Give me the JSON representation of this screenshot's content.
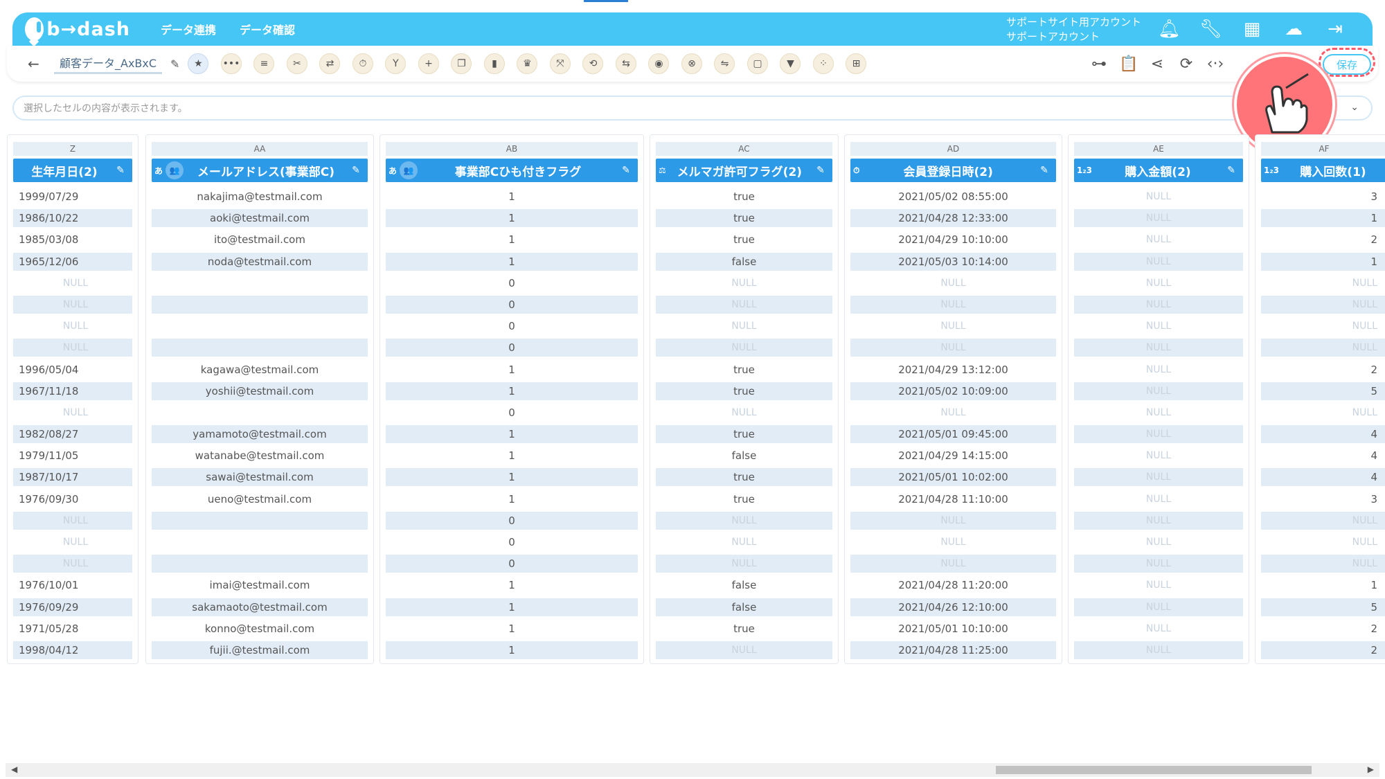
{
  "brand": {
    "logo_text": "b→dash"
  },
  "nav": {
    "links": [
      "データ連携",
      "データ確認"
    ]
  },
  "account": {
    "line1": "サポートサイト用アカウント",
    "line2": "サポートアカウント"
  },
  "top_icons": [
    "bell-icon",
    "wrench-icon",
    "apps-grid-icon",
    "chat-robot-icon",
    "logout-icon"
  ],
  "toolbar": {
    "back": "←",
    "file_name": "顧客データ_AxBxC",
    "save_label": "保存",
    "tools": [
      {
        "name": "favorite-star-icon",
        "glyph": "★"
      },
      {
        "name": "more-dots-icon",
        "glyph": "•••"
      },
      {
        "name": "list-icon",
        "glyph": "≡"
      },
      {
        "name": "scissors-tools-icon",
        "glyph": "✂"
      },
      {
        "name": "merge-arrows-icon",
        "glyph": "⇄"
      },
      {
        "name": "timer-icon",
        "glyph": "⏱"
      },
      {
        "name": "branch-icon",
        "glyph": "Y"
      },
      {
        "name": "add-icon",
        "glyph": "+"
      },
      {
        "name": "copy-icon",
        "glyph": "❐"
      },
      {
        "name": "trash-icon",
        "glyph": "▮"
      },
      {
        "name": "crown-icon",
        "glyph": "♛"
      },
      {
        "name": "expand-icon",
        "glyph": "⤧"
      },
      {
        "name": "repeat-icon",
        "glyph": "⟲"
      },
      {
        "name": "convert-icon",
        "glyph": "⇆"
      },
      {
        "name": "bag-icon",
        "glyph": "◉"
      },
      {
        "name": "cancel-circle-icon",
        "glyph": "⊗"
      },
      {
        "name": "replace-icon",
        "glyph": "⇋"
      },
      {
        "name": "frame-icon",
        "glyph": "▢"
      },
      {
        "name": "filter-icon",
        "glyph": "▼"
      },
      {
        "name": "grid-dots-icon",
        "glyph": "⁘"
      },
      {
        "name": "table-icon",
        "glyph": "⊞"
      }
    ],
    "right_tools": [
      {
        "name": "flow-icon",
        "glyph": "⊶"
      },
      {
        "name": "clipboard-icon",
        "glyph": "📋"
      },
      {
        "name": "share-icon",
        "glyph": "⋖"
      },
      {
        "name": "refresh-doc-icon",
        "glyph": "⟳"
      },
      {
        "name": "code-icon",
        "glyph": "‹·›"
      }
    ]
  },
  "cell_bar": {
    "placeholder": "選択したセルの内容が表示されます。"
  },
  "columns": [
    {
      "letter": "Z",
      "title": "生年月日(2)",
      "icons": [],
      "align": "left",
      "values": [
        "1999/07/29",
        "1986/10/22",
        "1985/03/08",
        "1965/12/06",
        "NULL",
        "NULL",
        "NULL",
        "NULL",
        "1996/05/04",
        "1967/11/18",
        "NULL",
        "1982/08/27",
        "1979/11/05",
        "1987/10/17",
        "1976/09/30",
        "NULL",
        "NULL",
        "NULL",
        "1976/10/01",
        "1976/09/29",
        "1971/05/28",
        "1998/04/12"
      ]
    },
    {
      "letter": "AA",
      "title": "メールアドレス(事業部C)",
      "icons": [
        "あ",
        "👥"
      ],
      "align": "center",
      "values": [
        "nakajima@testmail.com",
        "aoki@testmail.com",
        "ito@testmail.com",
        "noda@testmail.com",
        "",
        "",
        "",
        "",
        "kagawa@testmail.com",
        "yoshii@testmail.com",
        "",
        "yamamoto@testmail.com",
        "watanabe@testmail.com",
        "sawai@testmail.com",
        "ueno@testmail.com",
        "",
        "",
        "",
        "imai@testmail.com",
        "sakamaoto@testmail.com",
        "konno@testmail.com",
        "fujii.@testmail.com"
      ]
    },
    {
      "letter": "AB",
      "title": "事業部Cひも付きフラグ",
      "icons": [
        "あ",
        "👥"
      ],
      "align": "center",
      "values": [
        "1",
        "1",
        "1",
        "1",
        "0",
        "0",
        "0",
        "0",
        "1",
        "1",
        "0",
        "1",
        "1",
        "1",
        "1",
        "0",
        "0",
        "0",
        "1",
        "1",
        "1",
        "1"
      ]
    },
    {
      "letter": "AC",
      "title": "メルマガ許可フラグ(2)",
      "icons": [
        "⚖"
      ],
      "align": "center",
      "values": [
        "true",
        "true",
        "true",
        "false",
        "NULL",
        "NULL",
        "NULL",
        "NULL",
        "true",
        "true",
        "NULL",
        "true",
        "false",
        "true",
        "true",
        "NULL",
        "NULL",
        "NULL",
        "false",
        "false",
        "true",
        "NULL"
      ]
    },
    {
      "letter": "AD",
      "title": "会員登録日時(2)",
      "icons": [
        "⏱"
      ],
      "align": "center",
      "values": [
        "2021/05/02 08:55:00",
        "2021/04/28 12:33:00",
        "2021/04/29 10:10:00",
        "2021/05/03 10:14:00",
        "NULL",
        "NULL",
        "NULL",
        "NULL",
        "2021/04/29 13:12:00",
        "2021/05/02 10:09:00",
        "NULL",
        "2021/05/01 09:45:00",
        "2021/04/29 14:15:00",
        "2021/05/01 10:02:00",
        "2021/04/28 11:10:00",
        "NULL",
        "NULL",
        "NULL",
        "2021/04/28 11:20:00",
        "2021/04/26 12:10:00",
        "2021/05/01 10:10:00",
        "2021/04/28 11:25:00"
      ]
    },
    {
      "letter": "AE",
      "title": "購入金額(2)",
      "icons": [
        "1₂3"
      ],
      "align": "center",
      "values": [
        "NULL",
        "NULL",
        "NULL",
        "NULL",
        "NULL",
        "NULL",
        "NULL",
        "NULL",
        "NULL",
        "NULL",
        "NULL",
        "NULL",
        "NULL",
        "NULL",
        "NULL",
        "NULL",
        "NULL",
        "NULL",
        "NULL",
        "NULL",
        "NULL",
        "NULL"
      ]
    },
    {
      "letter": "AF",
      "title": "購入回数(1)",
      "icons": [
        "1₂3"
      ],
      "align": "right",
      "values": [
        "3",
        "1",
        "2",
        "1",
        "NULL",
        "NULL",
        "NULL",
        "NULL",
        "2",
        "5",
        "NULL",
        "4",
        "4",
        "4",
        "3",
        "NULL",
        "NULL",
        "NULL",
        "1",
        "5",
        "2",
        "2"
      ]
    }
  ],
  "colors": {
    "brand": "#45c6f5",
    "header": "#2d9ae8",
    "row_alt": "#e2ecf6",
    "highlight": "#ff5a6a"
  }
}
